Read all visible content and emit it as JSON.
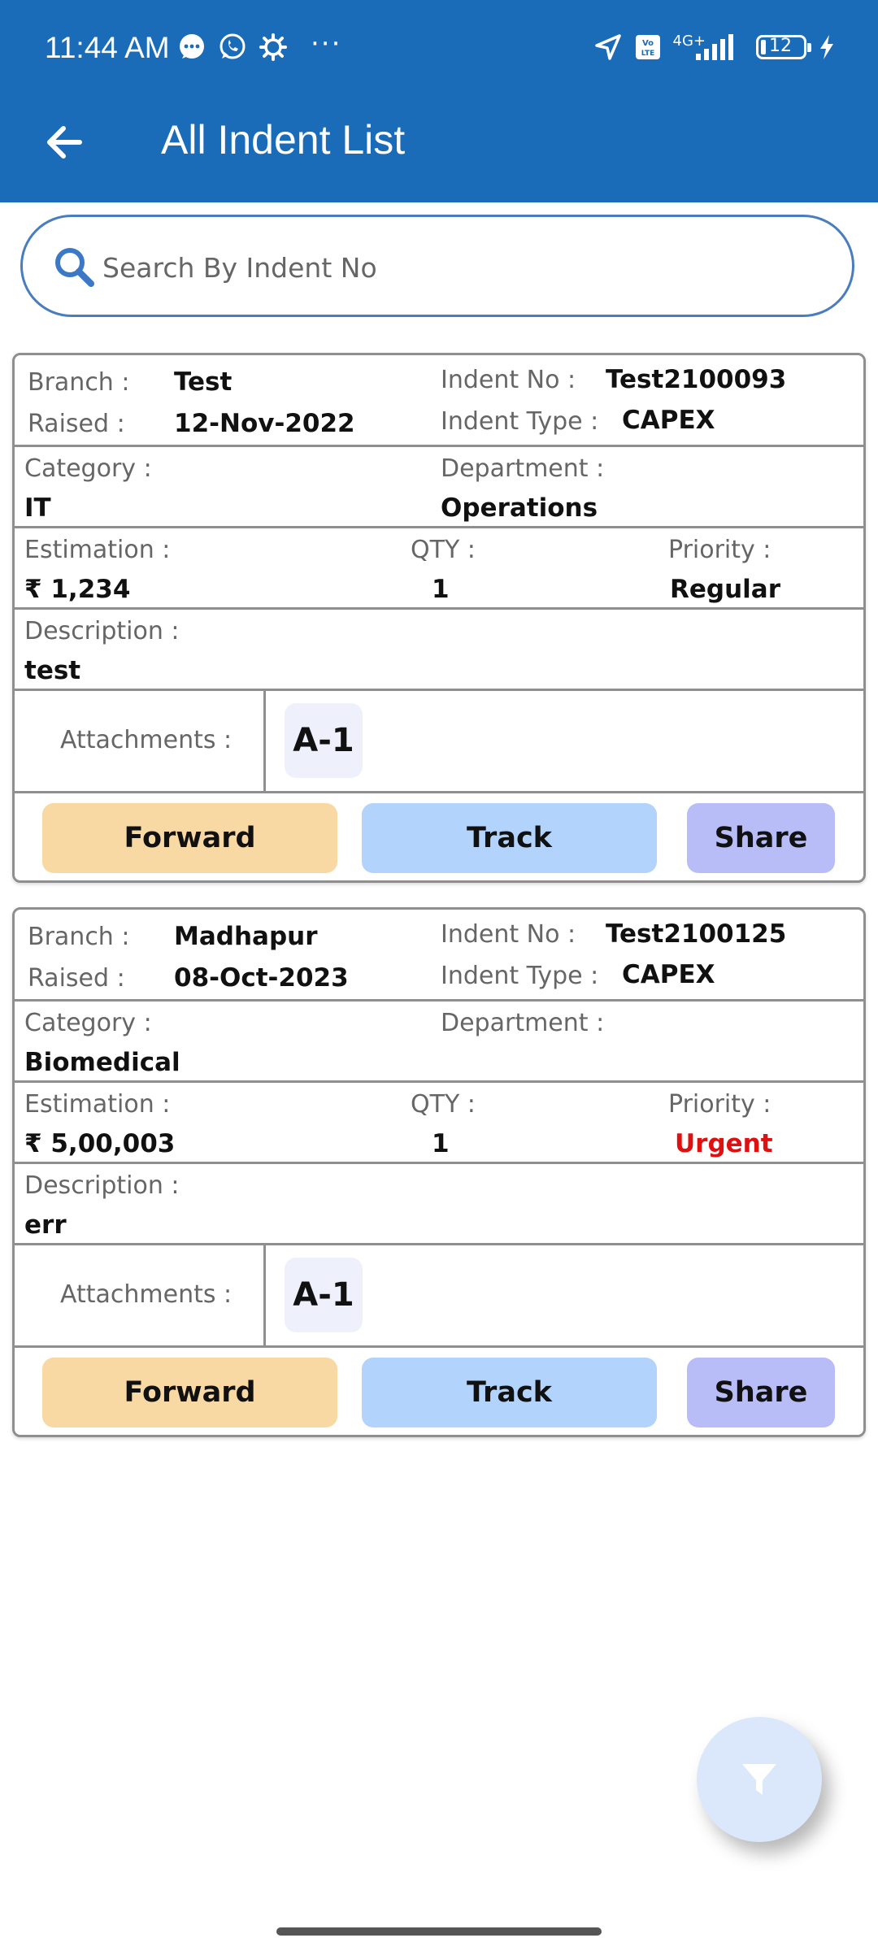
{
  "status_bar": {
    "time": "11:44 AM",
    "network": "4G+",
    "battery": "12"
  },
  "header": {
    "title": "All Indent List"
  },
  "search": {
    "placeholder": "Search By Indent No"
  },
  "labels": {
    "branch": "Branch :",
    "raised": "Raised :",
    "indent_no": "Indent No :",
    "indent_type": "Indent Type :",
    "category": "Category :",
    "department": "Department :",
    "estimation": "Estimation :",
    "qty": "QTY :",
    "priority": "Priority :",
    "description": "Description :",
    "attachments": "Attachments :",
    "forward": "Forward",
    "track": "Track",
    "share": "Share"
  },
  "indents": [
    {
      "branch": "Test",
      "raised": "12-Nov-2022",
      "indent_no": "Test2100093",
      "indent_type": "CAPEX",
      "category": "IT",
      "department": "Operations",
      "estimation": "₹ 1,234",
      "qty": "1",
      "priority": "Regular",
      "description": "test",
      "attachment": "A-1"
    },
    {
      "branch": "Madhapur",
      "raised": "08-Oct-2023",
      "indent_no": "Test2100125",
      "indent_type": "CAPEX",
      "category": "Biomedical",
      "department": "",
      "estimation": "₹ 5,00,003",
      "qty": "1",
      "priority": "Urgent",
      "description": "err",
      "attachment": "A-1"
    }
  ],
  "colors": {
    "app_bar": "#1a6bb8",
    "forward_button": "#f9d9a3",
    "track_button": "#b2d3fb",
    "share_button": "#b8bdf8",
    "urgent_priority": "#e01010",
    "fab": "#dbe8fb"
  },
  "icons": {
    "back": "arrow-left-icon",
    "search": "search-icon",
    "filter": "filter-icon"
  }
}
